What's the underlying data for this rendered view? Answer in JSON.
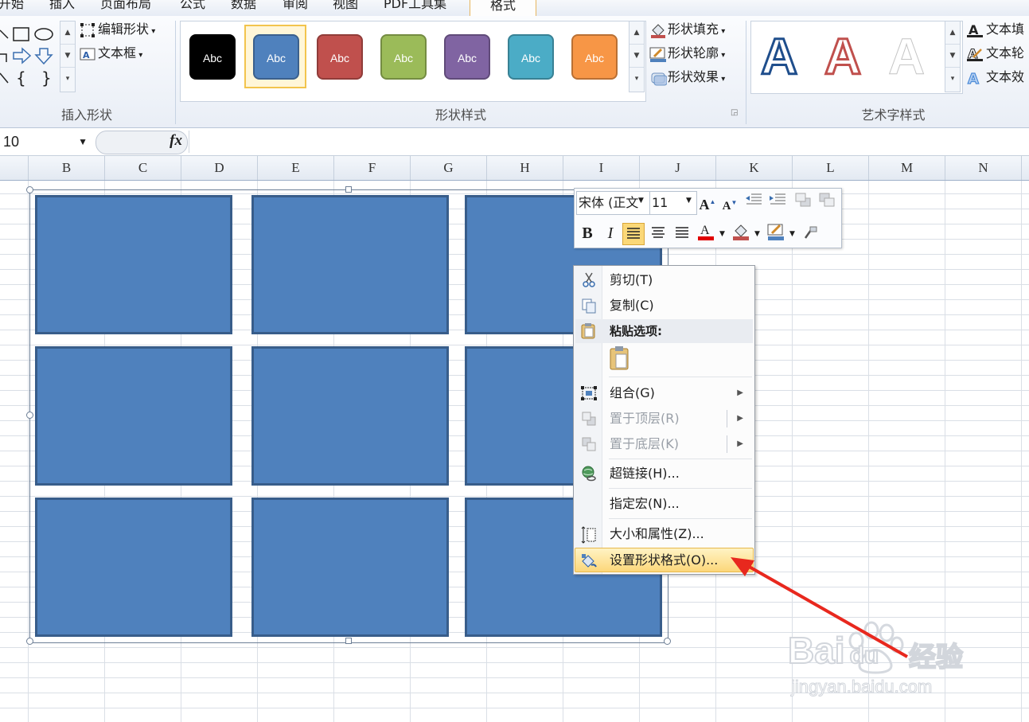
{
  "tabs": [
    "开始",
    "插入",
    "页面布局",
    "公式",
    "数据",
    "审阅",
    "视图",
    "PDF工具集",
    "格式"
  ],
  "ribbon": {
    "insert_shapes": {
      "edit_shape": "编辑形状",
      "text_box": "文本框",
      "label": "插入形状"
    },
    "shape_styles": {
      "swatch_text": "Abc",
      "label": "形状样式",
      "fill": "形状填充",
      "outline": "形状轮廓",
      "effects": "形状效果",
      "swatch_colors": [
        "#000000",
        "#4f81bd",
        "#c0504d",
        "#9bbb59",
        "#8064a2",
        "#4bacc6",
        "#f79646"
      ]
    },
    "wordart": {
      "glyph": "A",
      "text_fill": "文本填",
      "text_outline": "文本轮",
      "text_effects": "文本效",
      "label": "艺术字样式"
    }
  },
  "formula_bar": {
    "name_box": "10",
    "fx": "fx"
  },
  "columns": [
    "B",
    "C",
    "D",
    "E",
    "F",
    "G",
    "H",
    "I",
    "J",
    "K",
    "L",
    "M",
    "N"
  ],
  "mini_toolbar": {
    "font": "宋体 (正文",
    "size": "11"
  },
  "context_menu": {
    "cut": "剪切(T)",
    "copy": "复制(C)",
    "paste_header": "粘贴选项:",
    "group": "组合(G)",
    "bring_front": "置于顶层(R)",
    "send_back": "置于底层(K)",
    "hyperlink": "超链接(H)...",
    "assign_macro": "指定宏(N)...",
    "size_props": "大小和属性(Z)...",
    "format_shape": "设置形状格式(O)..."
  },
  "watermark": {
    "brand": "Bai",
    "brand2": "du",
    "cn": "经验",
    "url": "jingyan.baidu.com"
  },
  "colors": {
    "shape_fill": "#4f81bd",
    "shape_border": "#385d8a",
    "arrow": "#e8281e"
  }
}
